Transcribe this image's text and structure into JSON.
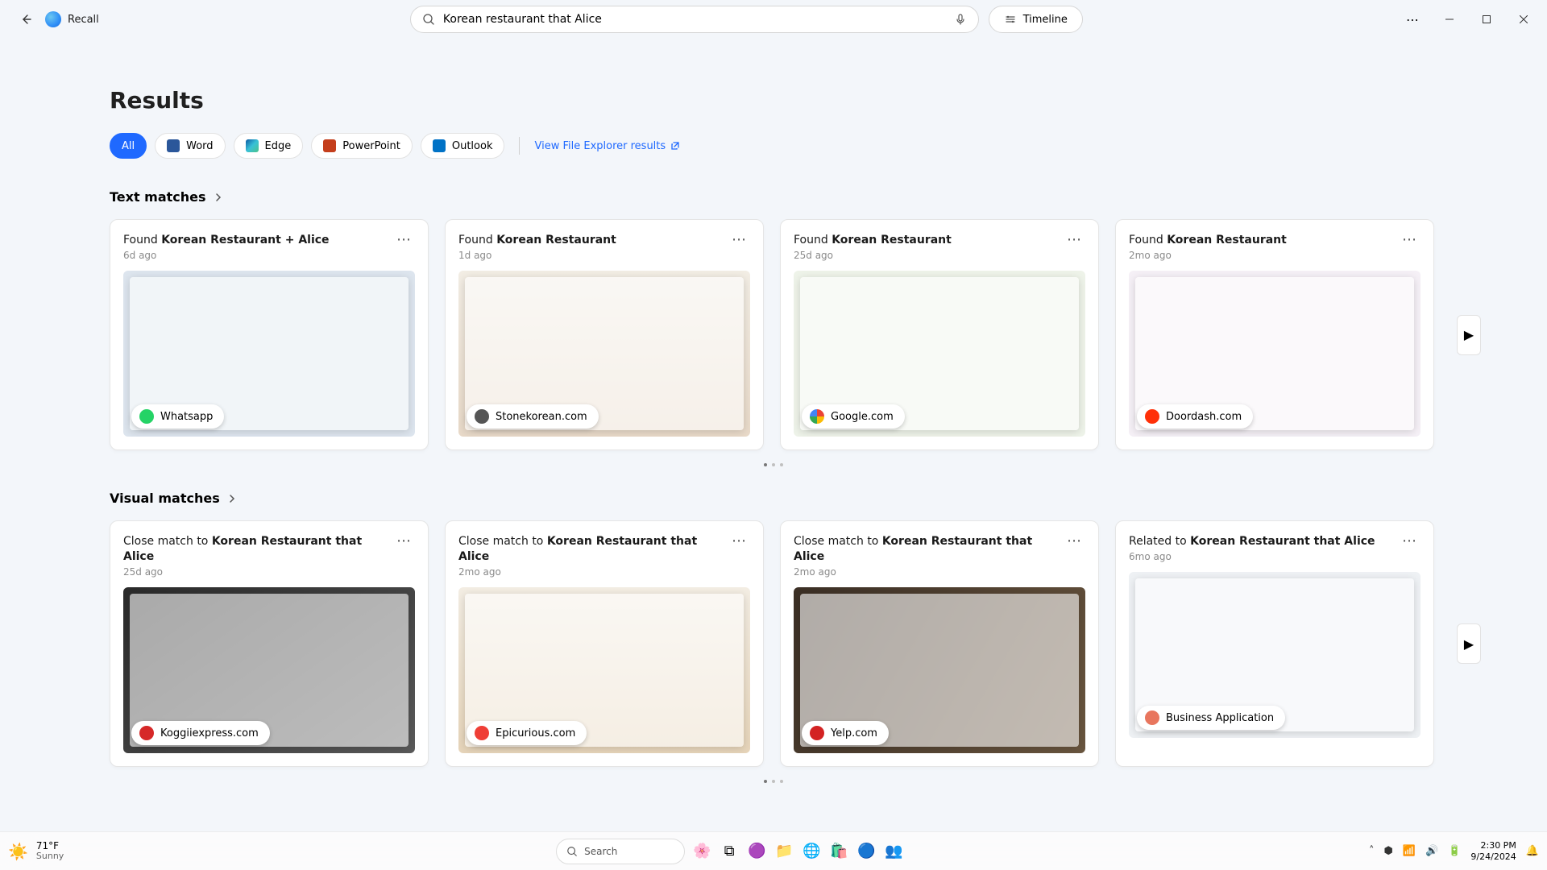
{
  "app": {
    "title": "Recall"
  },
  "search": {
    "value": "Korean restaurant that Alice",
    "placeholder": ""
  },
  "timeline_label": "Timeline",
  "results_heading": "Results",
  "filters": {
    "all": "All",
    "items": [
      "Word",
      "Edge",
      "PowerPoint",
      "Outlook"
    ]
  },
  "file_explorer_link": "View File Explorer results",
  "sections": {
    "text_matches": "Text matches",
    "visual_matches": "Visual matches"
  },
  "text_cards": [
    {
      "prefix": "Found",
      "bold": "Korean Restaurant + Alice",
      "age": "6d ago",
      "source": "Whatsapp",
      "dot": "wa",
      "thumb": "t1"
    },
    {
      "prefix": "Found",
      "bold": "Korean Restaurant",
      "age": "1d ago",
      "source": "Stonekorean.com",
      "dot": "stone",
      "thumb": "t2"
    },
    {
      "prefix": "Found",
      "bold": "Korean Restaurant",
      "age": "25d ago",
      "source": "Google.com",
      "dot": "goog",
      "thumb": "t3"
    },
    {
      "prefix": "Found",
      "bold": "Korean Restaurant",
      "age": "2mo ago",
      "source": "Doordash.com",
      "dot": "dd",
      "thumb": "t4"
    }
  ],
  "visual_cards": [
    {
      "prefix": "Close match to",
      "bold": "Korean Restaurant that Alice",
      "age": "25d ago",
      "source": "Koggiiexpress.com",
      "dot": "kog",
      "thumb": "v1"
    },
    {
      "prefix": "Close match to",
      "bold": "Korean Restaurant that Alice",
      "age": "2mo ago",
      "source": "Epicurious.com",
      "dot": "epi",
      "thumb": "v2"
    },
    {
      "prefix": "Close match to",
      "bold": "Korean Restaurant that Alice",
      "age": "2mo ago",
      "source": "Yelp.com",
      "dot": "yelp",
      "thumb": "v3"
    },
    {
      "prefix": "Related to",
      "bold": "Korean Restaurant that Alice",
      "age": "6mo ago",
      "source": "Business Application",
      "dot": "doc",
      "thumb": "v4"
    }
  ],
  "taskbar": {
    "weather_temp": "71°F",
    "weather_desc": "Sunny",
    "search_label": "Search",
    "time": "2:30 PM",
    "date": "9/24/2024"
  }
}
